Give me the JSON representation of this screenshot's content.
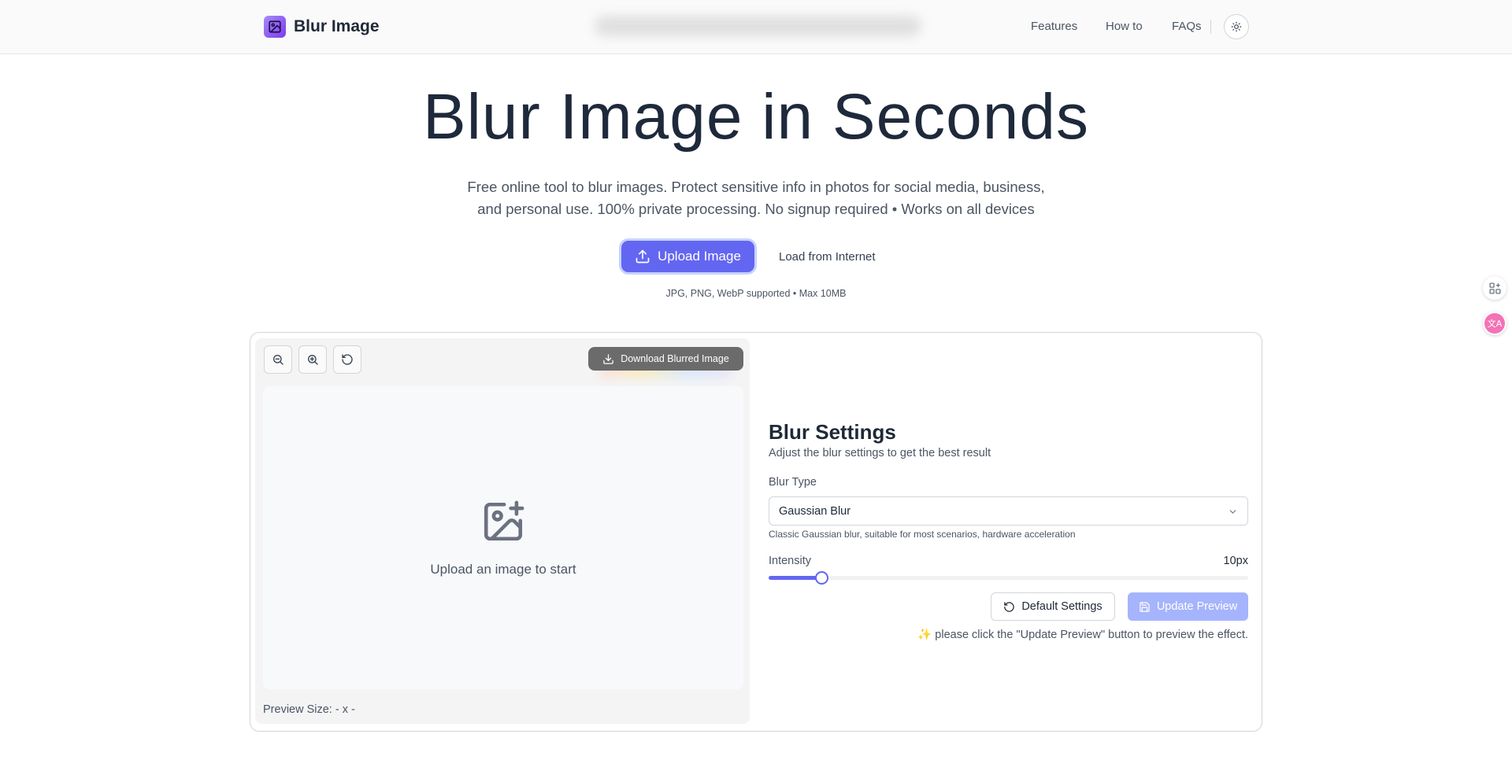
{
  "header": {
    "app_name": "Blur Image",
    "nav": [
      "Features",
      "How to",
      "FAQs"
    ],
    "theme_icon": "sun-icon"
  },
  "hero": {
    "title": "Blur Image in Seconds",
    "subtitle_line1": "Free online tool to blur images. Protect sensitive info in photos for social media, business,",
    "subtitle_line2": "and personal use. 100% private processing. No signup required • Works on all devices",
    "upload_label": "Upload Image",
    "load_label": "Load from Internet",
    "support_note": "JPG, PNG, WebP supported • Max 10MB"
  },
  "editor": {
    "download_label": "Download Blurred Image",
    "empty_text": "Upload an image to start",
    "preview_size": "Preview Size: - x -"
  },
  "settings": {
    "title": "Blur Settings",
    "subtitle": "Adjust the blur settings to get the best result",
    "blur_type_label": "Blur Type",
    "blur_type_value": "Gaussian Blur",
    "blur_type_hint": "Classic Gaussian blur, suitable for most scenarios, hardware acceleration",
    "intensity_label": "Intensity",
    "intensity_value": "10px",
    "intensity_fraction": 0.11,
    "default_label": "Default Settings",
    "update_label": "Update Preview",
    "update_note": "please click the \"Update Preview\" button to preview the effect."
  },
  "colors": {
    "accent": "#6366f1",
    "accent_disabled": "#a5b4fc"
  }
}
